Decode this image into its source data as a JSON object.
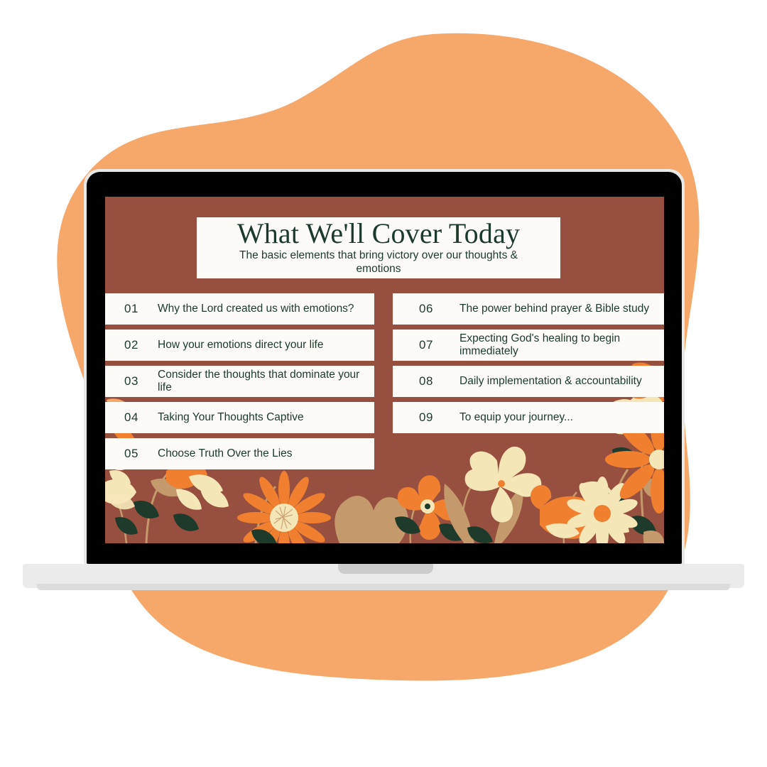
{
  "colors": {
    "blob_orange": "#f5a86a",
    "slide_background": "#97503f",
    "card_background": "#fdfbf7",
    "text_green": "#1b3a2b",
    "laptop_bezel": "#000000",
    "laptop_body": "#e8e8e6",
    "laptop_base": "#ebebeb",
    "trackpad": "#cccccc",
    "floral_orange": "#f08030",
    "floral_cream": "#f5e6b8",
    "floral_tan": "#c49a6c",
    "floral_green": "#1d3a2a"
  },
  "slide": {
    "title": "What We'll Cover Today",
    "subtitle": "The basic elements that bring victory over our thoughts & emotions",
    "left_column": [
      {
        "number": "01",
        "text": "Why the Lord created us with emotions?"
      },
      {
        "number": "02",
        "text": "How your emotions direct your life"
      },
      {
        "number": "03",
        "text": "Consider the thoughts that dominate your life"
      },
      {
        "number": "04",
        "text": "Taking Your Thoughts Captive"
      },
      {
        "number": "05",
        "text": "Choose Truth Over the Lies"
      }
    ],
    "right_column": [
      {
        "number": "06",
        "text": "The power behind prayer & Bible study"
      },
      {
        "number": "07",
        "text": "Expecting God's healing to begin immediately"
      },
      {
        "number": "08",
        "text": "Daily implementation & accountability"
      },
      {
        "number": "09",
        "text": "To equip your journey..."
      }
    ]
  },
  "decorations": {
    "blob_name": "orange-organic-blob",
    "floral_border_name": "autumn-floral-border"
  }
}
